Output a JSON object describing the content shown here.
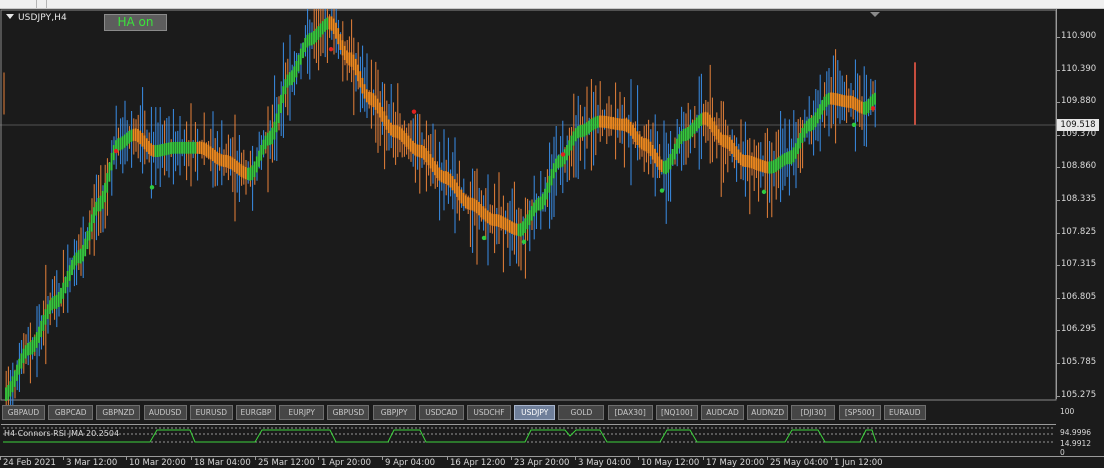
{
  "chart": {
    "symbol": "USDJPY,H4",
    "ha_button": "HA on",
    "current_price": "109.518",
    "price_ticks": [
      "110.900",
      "110.390",
      "109.880",
      "109.370",
      "108.860",
      "108.335",
      "107.825",
      "107.315",
      "106.805",
      "106.295",
      "105.785",
      "105.275"
    ],
    "price_range": [
      105.2,
      111.1
    ]
  },
  "pairs": [
    "GBPAUD",
    "GBPCAD",
    "GBPNZD",
    "AUDUSD",
    "EURUSD",
    "EURGBP",
    "EURJPY",
    "GBPUSD",
    "GBPJPY",
    "USDCAD",
    "USDCHF",
    "USDJPY",
    "GOLD",
    "[DAX30]",
    "[NQ100]",
    "AUDCAD",
    "AUDNZD",
    "[DJI30]",
    "[SP500]",
    "EURAUD"
  ],
  "active_pair": "USDJPY",
  "indicator": {
    "label": "H4 Connors RSI JMA 20.2504",
    "axis_top": "100",
    "axis_mid_a": "94.9996",
    "axis_mid_b": "14.9912",
    "axis_bottom": "0"
  },
  "time_ticks": [
    "24 Feb 2021",
    "3 Mar 12:00",
    "10 Mar 20:00",
    "18 Mar 04:00",
    "25 Mar 12:00",
    "1 Apr 20:00",
    "9 Apr 04:00",
    "16 Apr 12:00",
    "23 Apr 20:00",
    "3 May 04:00",
    "10 May 12:00",
    "17 May 20:00",
    "25 May 04:00",
    "1 Jun 12:00"
  ],
  "colors": {
    "background": "#1b1b1b",
    "bull_candle": "#3a8ee8",
    "bear_candle": "#e8823a",
    "ha_up": "#35c93d",
    "ha_down": "#f08a1e",
    "indicator_line": "#3cd33c",
    "signal_dot_up": "#2ecc40",
    "signal_dot_down": "#e02020"
  }
}
